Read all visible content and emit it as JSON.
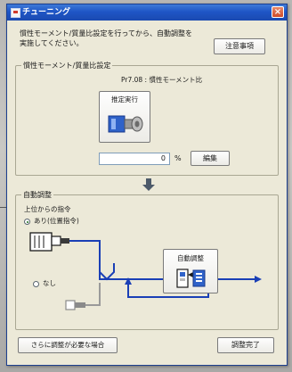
{
  "window": {
    "title": "チューニング",
    "close_label": "×"
  },
  "intro_text": "慣性モーメント/質量比設定を行ってから、自動調整を実施してください。",
  "buttons": {
    "notes": "注意事項",
    "edit": "編集",
    "measure": "推定実行",
    "auto_tune": "自動調整",
    "manual": "さらに調整が必要な場合",
    "finish": "調整完了"
  },
  "inertia_group": {
    "title": "慣性モーメント/質量比設定",
    "param_label": "Pr7.08 : 慣性モーメント比",
    "value": "0",
    "unit": "%"
  },
  "auto_group": {
    "title": "自動調整",
    "command_label": "上位からの指令",
    "option_with": "あり(位置指令)",
    "option_without": "なし"
  },
  "colors": {
    "title_bar": "#1f56c6",
    "window_bg": "#ece9d8",
    "wire_blue": "#1a3fb6"
  }
}
